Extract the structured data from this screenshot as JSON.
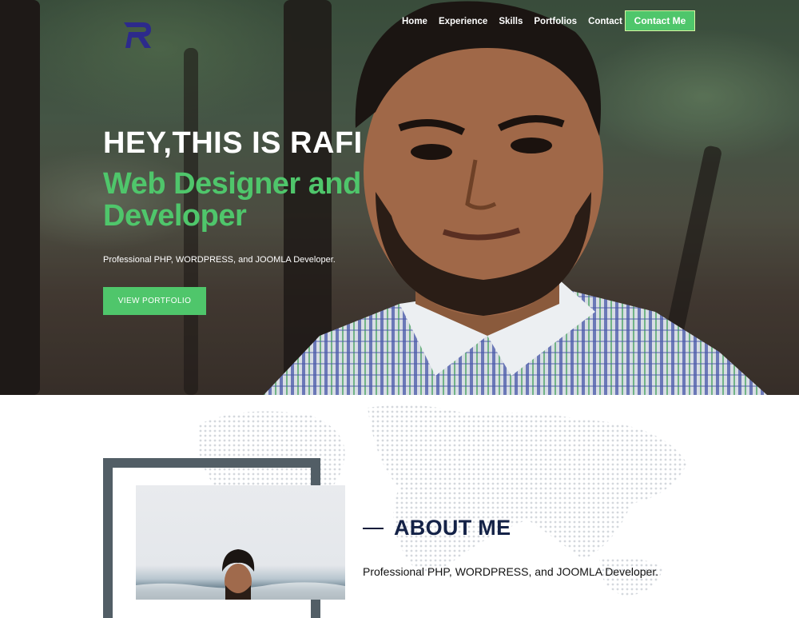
{
  "nav": {
    "items": [
      {
        "label": "Home"
      },
      {
        "label": "Experience"
      },
      {
        "label": "Skills"
      },
      {
        "label": "Portfolios"
      },
      {
        "label": "Contact"
      }
    ],
    "cta_label": "Contact Me",
    "logo_icon": "R-logo-icon"
  },
  "hero": {
    "greeting": "HEY,THIS IS RAFI",
    "role": "Web Designer and Developer",
    "subtitle": "Professional PHP, WORDPRESS, and JOOMLA Developer.",
    "button_label": "VIEW PORTFOLIO"
  },
  "about": {
    "title": "ABOUT ME",
    "text": "Professional PHP, WORDPRESS, and JOOMLA Developer."
  },
  "colors": {
    "accent": "#4fc66b",
    "heading_dark": "#142247",
    "frame": "#525e66",
    "logo": "#2d2a8c"
  }
}
